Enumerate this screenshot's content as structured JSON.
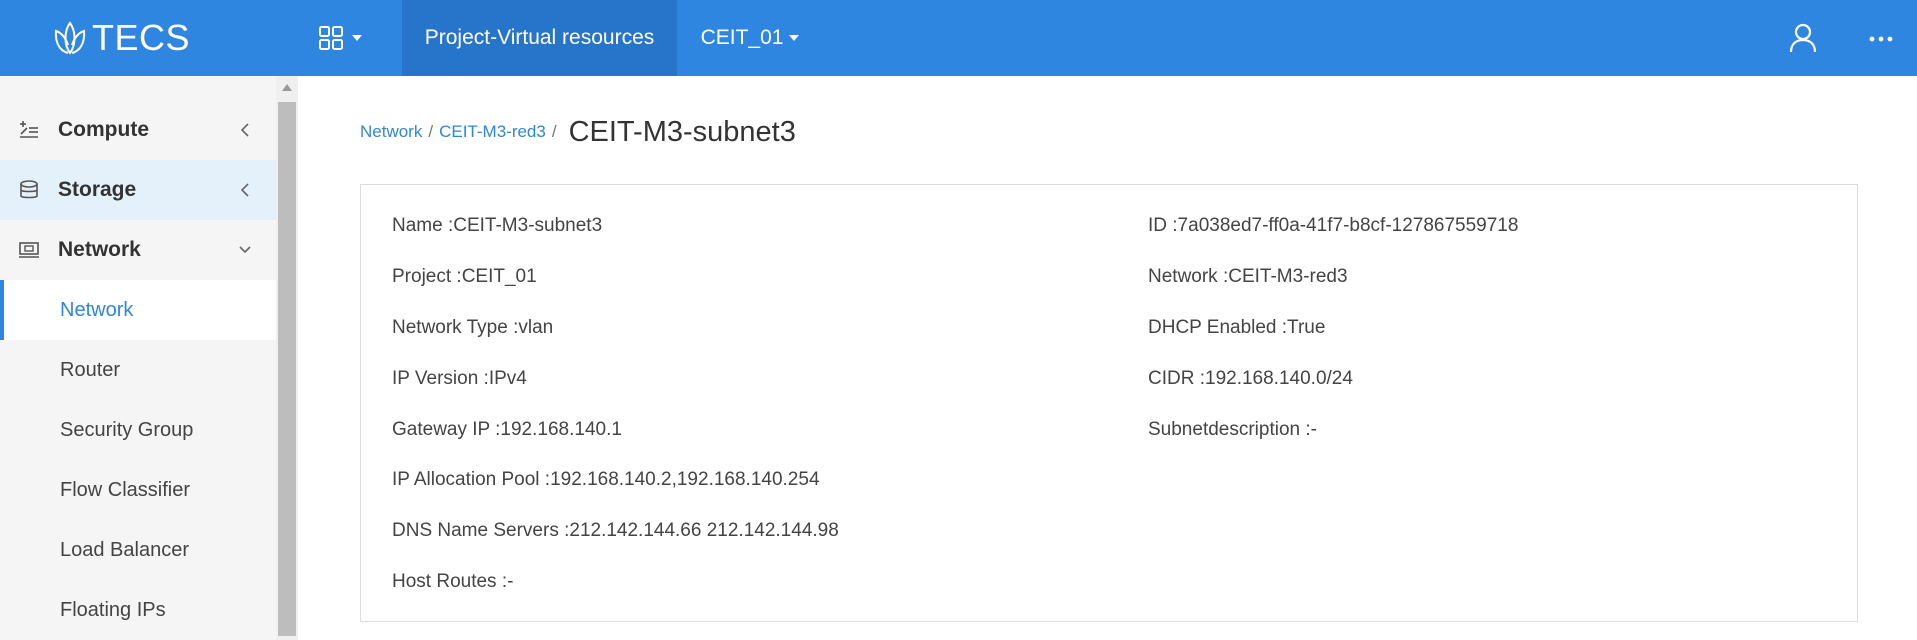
{
  "header": {
    "logo_text": "TECS",
    "tabs": [
      {
        "label": "Project-Virtual resources",
        "active": true
      },
      {
        "label": "CEIT_01",
        "dropdown": true
      }
    ],
    "icons": [
      "apps-grid-icon",
      "user-icon",
      "more-horizontal-icon"
    ],
    "colors": {
      "bar": "#2f86e0",
      "active_tab": "#2675cb"
    }
  },
  "sidebar": {
    "groups": [
      {
        "label": "Compute",
        "icon": "compute-icon",
        "expanded": false
      },
      {
        "label": "Storage",
        "icon": "storage-icon",
        "expanded": false
      },
      {
        "label": "Network",
        "icon": "network-icon",
        "expanded": true
      }
    ],
    "items": [
      {
        "label": "Network",
        "active": true
      },
      {
        "label": "Router"
      },
      {
        "label": "Security Group"
      },
      {
        "label": "Flow Classifier"
      },
      {
        "label": "Load Balancer"
      },
      {
        "label": "Floating IPs"
      }
    ]
  },
  "breadcrumb": {
    "items": [
      "Network",
      "CEIT-M3-red3"
    ],
    "separator": "/",
    "current": "CEIT-M3-subnet3"
  },
  "details": {
    "left": [
      "Name :CEIT-M3-subnet3",
      "Project :CEIT_01",
      "Network Type :vlan",
      "IP Version :IPv4",
      "Gateway IP :192.168.140.1",
      "IP Allocation Pool :192.168.140.2,192.168.140.254",
      "DNS Name Servers :212.142.144.66 212.142.144.98",
      "Host Routes :-"
    ],
    "right": [
      "ID :7a038ed7-ff0a-41f7-b8cf-127867559718",
      "Network :CEIT-M3-red3",
      "DHCP Enabled :True",
      "CIDR :192.168.140.0/24",
      "Subnetdescription :-"
    ]
  }
}
